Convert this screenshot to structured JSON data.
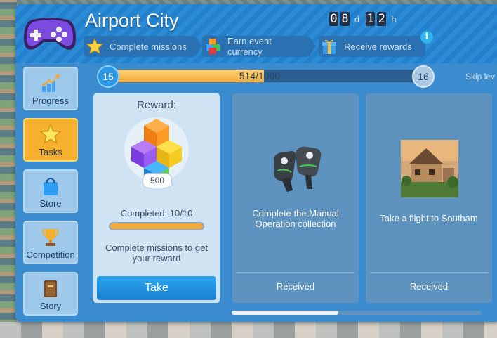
{
  "header": {
    "title": "Airport City",
    "timer": {
      "days": "08",
      "days_unit": "d",
      "hours": "12",
      "hours_unit": "h"
    },
    "steps": [
      {
        "label": "Complete missions",
        "icon": "star-icon"
      },
      {
        "label": "Earn event currency",
        "icon": "cube-icon"
      },
      {
        "label": "Receive rewards",
        "icon": "gift-icon"
      }
    ],
    "info_label": "i"
  },
  "sidebar": {
    "items": [
      {
        "label": "Progress",
        "icon": "progress-arrow-icon",
        "active": false
      },
      {
        "label": "Tasks",
        "icon": "star-icon",
        "active": true
      },
      {
        "label": "Store",
        "icon": "shopping-bag-icon",
        "active": false
      },
      {
        "label": "Competition",
        "icon": "trophy-icon",
        "active": false
      },
      {
        "label": "Story",
        "icon": "book-icon",
        "active": false
      }
    ]
  },
  "progress": {
    "current_level": "15",
    "next_level": "16",
    "text": "514/1000",
    "fraction": 0.514,
    "skip_label": "Skip lev"
  },
  "reward_card": {
    "label": "Reward:",
    "amount": "500",
    "completed": "Completed: 10/10",
    "completed_fraction": 1.0,
    "hint": "Complete missions to get your reward",
    "button": "Take"
  },
  "tasks": [
    {
      "name": "Complete the Manual Operation collection",
      "status": "Received",
      "image": "vr-controller-icon"
    },
    {
      "name": "Take a flight to Southam",
      "status": "Received",
      "image": "cottage-photo"
    }
  ],
  "colors": {
    "accent": "#3a8fd0",
    "active_tab": "#f5b12e",
    "button": "#1a80d1"
  }
}
